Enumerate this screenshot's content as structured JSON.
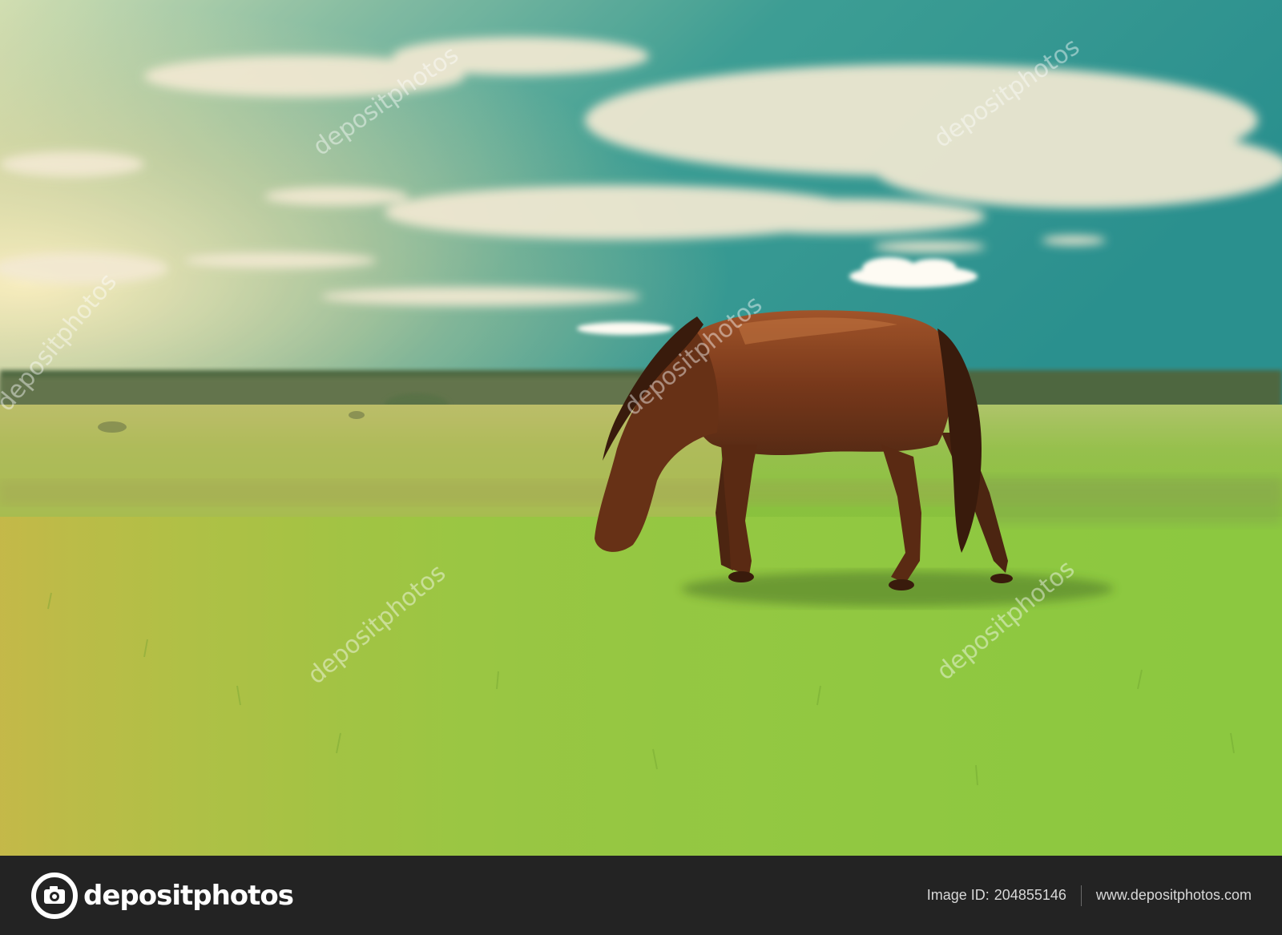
{
  "photo": {
    "subject": "horse-grazing-in-meadow",
    "watermark_text": "depositphotos",
    "colors": {
      "sky_top": "#1f8f8f",
      "sky_glow": "#e8d9a8",
      "cloud": "#f2efe6",
      "treeline": "#3b5a3a",
      "field_far": "#9fc65a",
      "grass_near": "#8fcf3e",
      "horse": "#6b2a14"
    }
  },
  "footer": {
    "brand_name": "depositphotos",
    "brand_icon": "camera-icon",
    "image_id_label": "Image ID:",
    "image_id_value": "204855146",
    "website": "www.depositphotos.com",
    "background": "#232323"
  }
}
